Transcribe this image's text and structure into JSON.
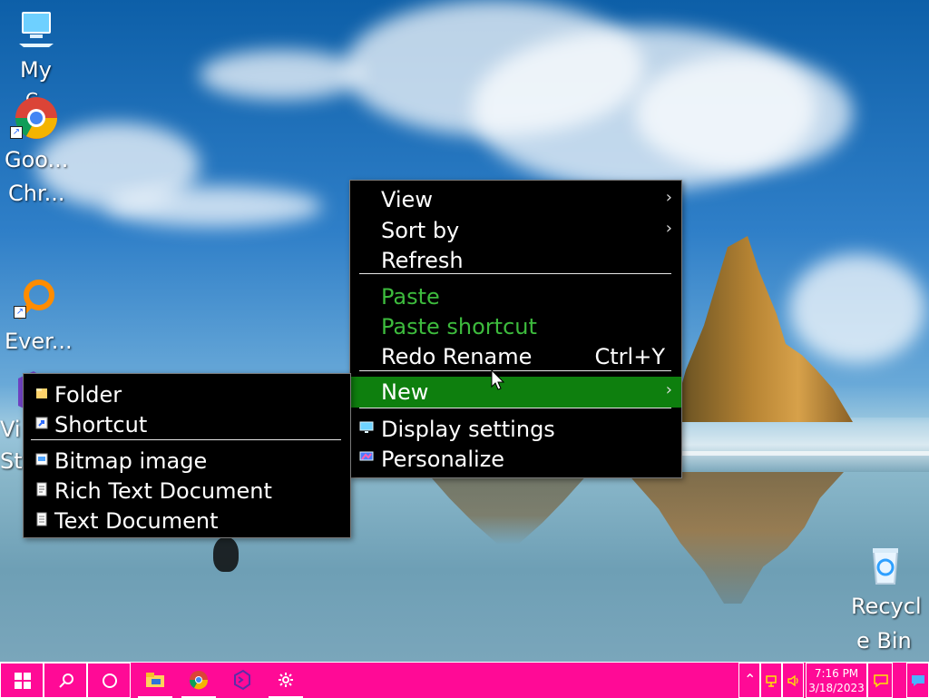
{
  "desktop": {
    "icons": [
      {
        "label": "My",
        "sublabel": "C"
      },
      {
        "label": "Goo...",
        "sublabel": "Chr..."
      },
      {
        "label": "Ever..."
      },
      {
        "label": "Vi",
        "sublabel": "St"
      },
      {
        "label": "Recycl",
        "sublabel": "e Bin"
      }
    ]
  },
  "context_menu": {
    "items": [
      {
        "label": "View",
        "has_submenu": true
      },
      {
        "label": "Sort by",
        "has_submenu": true
      },
      {
        "label": "Refresh"
      },
      {
        "label": "Paste",
        "color": "#3dbb3d"
      },
      {
        "label": "Paste shortcut",
        "color": "#3dbb3d"
      },
      {
        "label": "Redo Rename",
        "shortcut": "Ctrl+Y"
      },
      {
        "label": "New",
        "has_submenu": true,
        "selected": true,
        "highlight_color": "#0e7f0e"
      },
      {
        "label": "Display settings"
      },
      {
        "label": "Personalize"
      }
    ]
  },
  "new_submenu": {
    "items": [
      {
        "label": "Folder"
      },
      {
        "label": "Shortcut"
      },
      {
        "label": "Bitmap image"
      },
      {
        "label": "Rich Text Document"
      },
      {
        "label": "Text Document"
      }
    ]
  },
  "taskbar": {
    "background": "#ff0a96",
    "clock_time": "7:16 PM",
    "clock_date": "3/18/2023"
  }
}
